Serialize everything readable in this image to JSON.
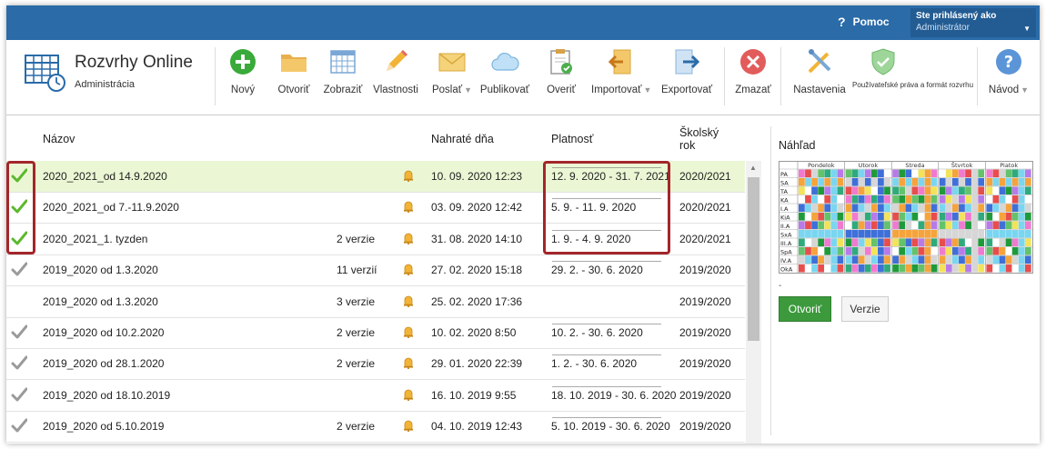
{
  "topbar": {
    "help_label": "Pomoc",
    "user_caption": "Ste prihlásený ako",
    "user_name": "Administrátor"
  },
  "app": {
    "title": "Rozvrhy Online",
    "subtitle": "Administrácia"
  },
  "toolbar": {
    "new": "Nový",
    "open": "Otvoriť",
    "show": "Zobraziť",
    "properties": "Vlastnosti",
    "send": "Poslať",
    "publish": "Publikovať",
    "verify": "Overiť",
    "import": "Importovať",
    "export": "Exportovať",
    "delete": "Zmazať",
    "settings": "Nastavenia",
    "rights": "Používateľské práva a formát rozvrhu",
    "guide": "Návod"
  },
  "table": {
    "headers": {
      "name": "Názov",
      "uploaded": "Nahraté dňa",
      "validity": "Platnosť",
      "school_year_1": "Školský",
      "school_year_2": "rok"
    },
    "rows": [
      {
        "check": true,
        "name": "2020_2021_od 14.9.2020",
        "versions": "",
        "uploaded": "10. 09. 2020 12:23",
        "validity": "12. 9. 2020 - 31. 7. 2021",
        "year": "2020/2021",
        "selected": true
      },
      {
        "check": true,
        "name": "2020_2021_od 7.-11.9.2020",
        "versions": "",
        "uploaded": "03. 09. 2020 12:42",
        "validity": "5. 9. - 11. 9. 2020",
        "year": "2020/2021"
      },
      {
        "check": true,
        "name": "2020_2021_1. tyzden",
        "versions": "2 verzie",
        "uploaded": "31. 08. 2020 14:10",
        "validity": "1. 9. - 4. 9. 2020",
        "year": "2020/2021"
      },
      {
        "check": true,
        "name": "2019_2020 od 1.3.2020",
        "versions": "11 verzií",
        "uploaded": "27. 02. 2020 15:18",
        "validity": "29. 2. - 30. 6. 2020",
        "year": "2019/2020"
      },
      {
        "check": false,
        "name": "2019_2020 od 1.3.2020",
        "versions": "3 verzie",
        "uploaded": "25. 02. 2020 17:36",
        "validity": "",
        "year": "2019/2020"
      },
      {
        "check": true,
        "name": "2019_2020 od 10.2.2020",
        "versions": "2 verzie",
        "uploaded": "10. 02. 2020 8:50",
        "validity": "10. 2. - 30. 6. 2020",
        "year": "2019/2020"
      },
      {
        "check": true,
        "name": "2019_2020 od 28.1.2020",
        "versions": "2 verzie",
        "uploaded": "29. 01. 2020 22:39",
        "validity": "1. 2. - 30. 6. 2020",
        "year": "2019/2020"
      },
      {
        "check": true,
        "name": "2019_2020 od 18.10.2019",
        "versions": "",
        "uploaded": "16. 10. 2019 9:55",
        "validity": "18. 10. 2019 - 30. 6. 2020",
        "year": "2019/2020"
      },
      {
        "check": true,
        "name": "2019_2020 od 5.10.2019",
        "versions": "2 verzie",
        "uploaded": "04. 10. 2019 12:43",
        "validity": "5. 10. 2019 - 30. 6. 2020",
        "year": "2019/2020"
      }
    ]
  },
  "preview": {
    "title": "Náhľad",
    "days": [
      "Pondelok",
      "Utorok",
      "Streda",
      "Štvrtok",
      "Piatok"
    ],
    "classes": [
      "PA",
      "SA",
      "TA",
      "KA",
      "I.A",
      "KiA",
      "II.A",
      "SxA",
      "III.A",
      "SpA",
      "IV.A",
      "OkA"
    ],
    "dash": "-",
    "open_button": "Otvoriť",
    "versions_button": "Verzie"
  },
  "colors": {
    "topbar": "#2a6ba8",
    "selected_row": "#ebf7d4",
    "check_green": "#5cb82e",
    "check_grey": "#9a9a9a",
    "highlight_red": "#a3262a",
    "open_button": "#3c9a3c"
  },
  "icons": [
    "help-icon",
    "timetable-logo-icon",
    "plus-icon",
    "folder-icon",
    "grid-icon",
    "pencil-icon",
    "envelope-icon",
    "cloud-icon",
    "clipboard-check-icon",
    "import-icon",
    "export-icon",
    "delete-x-icon",
    "tools-icon",
    "shield-icon",
    "question-icon",
    "checkmark-icon",
    "bell-icon"
  ]
}
